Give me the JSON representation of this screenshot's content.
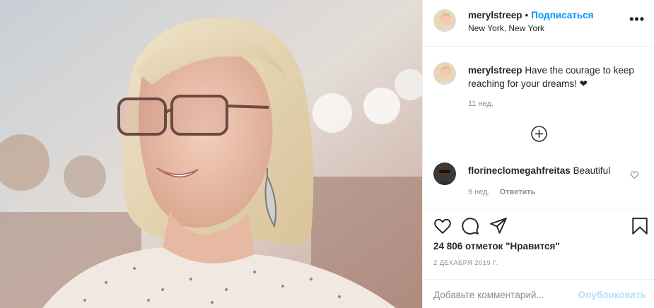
{
  "header": {
    "username": "merylstreep",
    "separator": "•",
    "follow_label": "Подписаться",
    "location": "New York, New York",
    "more_label": "•••"
  },
  "caption": {
    "username": "merylstreep",
    "text": "Have the courage to keep reaching for your dreams! ❤",
    "time": "11 нед."
  },
  "comments": [
    {
      "username": "florineclomegahfreitas",
      "text": "Beautiful",
      "time": "9 нед.",
      "reply_label": "Ответить"
    }
  ],
  "actions": {
    "likes_text": "24 806 отметок \"Нравится\"",
    "date": "2 ДЕКАБРЯ 2019 Г.",
    "icons": [
      "heart-icon",
      "comment-icon",
      "share-icon",
      "bookmark-icon"
    ]
  },
  "add_comment": {
    "placeholder": "Добавьте комментарий...",
    "post_label": "Опубликовать"
  },
  "colors": {
    "link_blue": "#0095f6",
    "post_disabled": "#b2dffc",
    "muted": "#8e8e8e",
    "text": "#262626",
    "border": "#efefef"
  }
}
